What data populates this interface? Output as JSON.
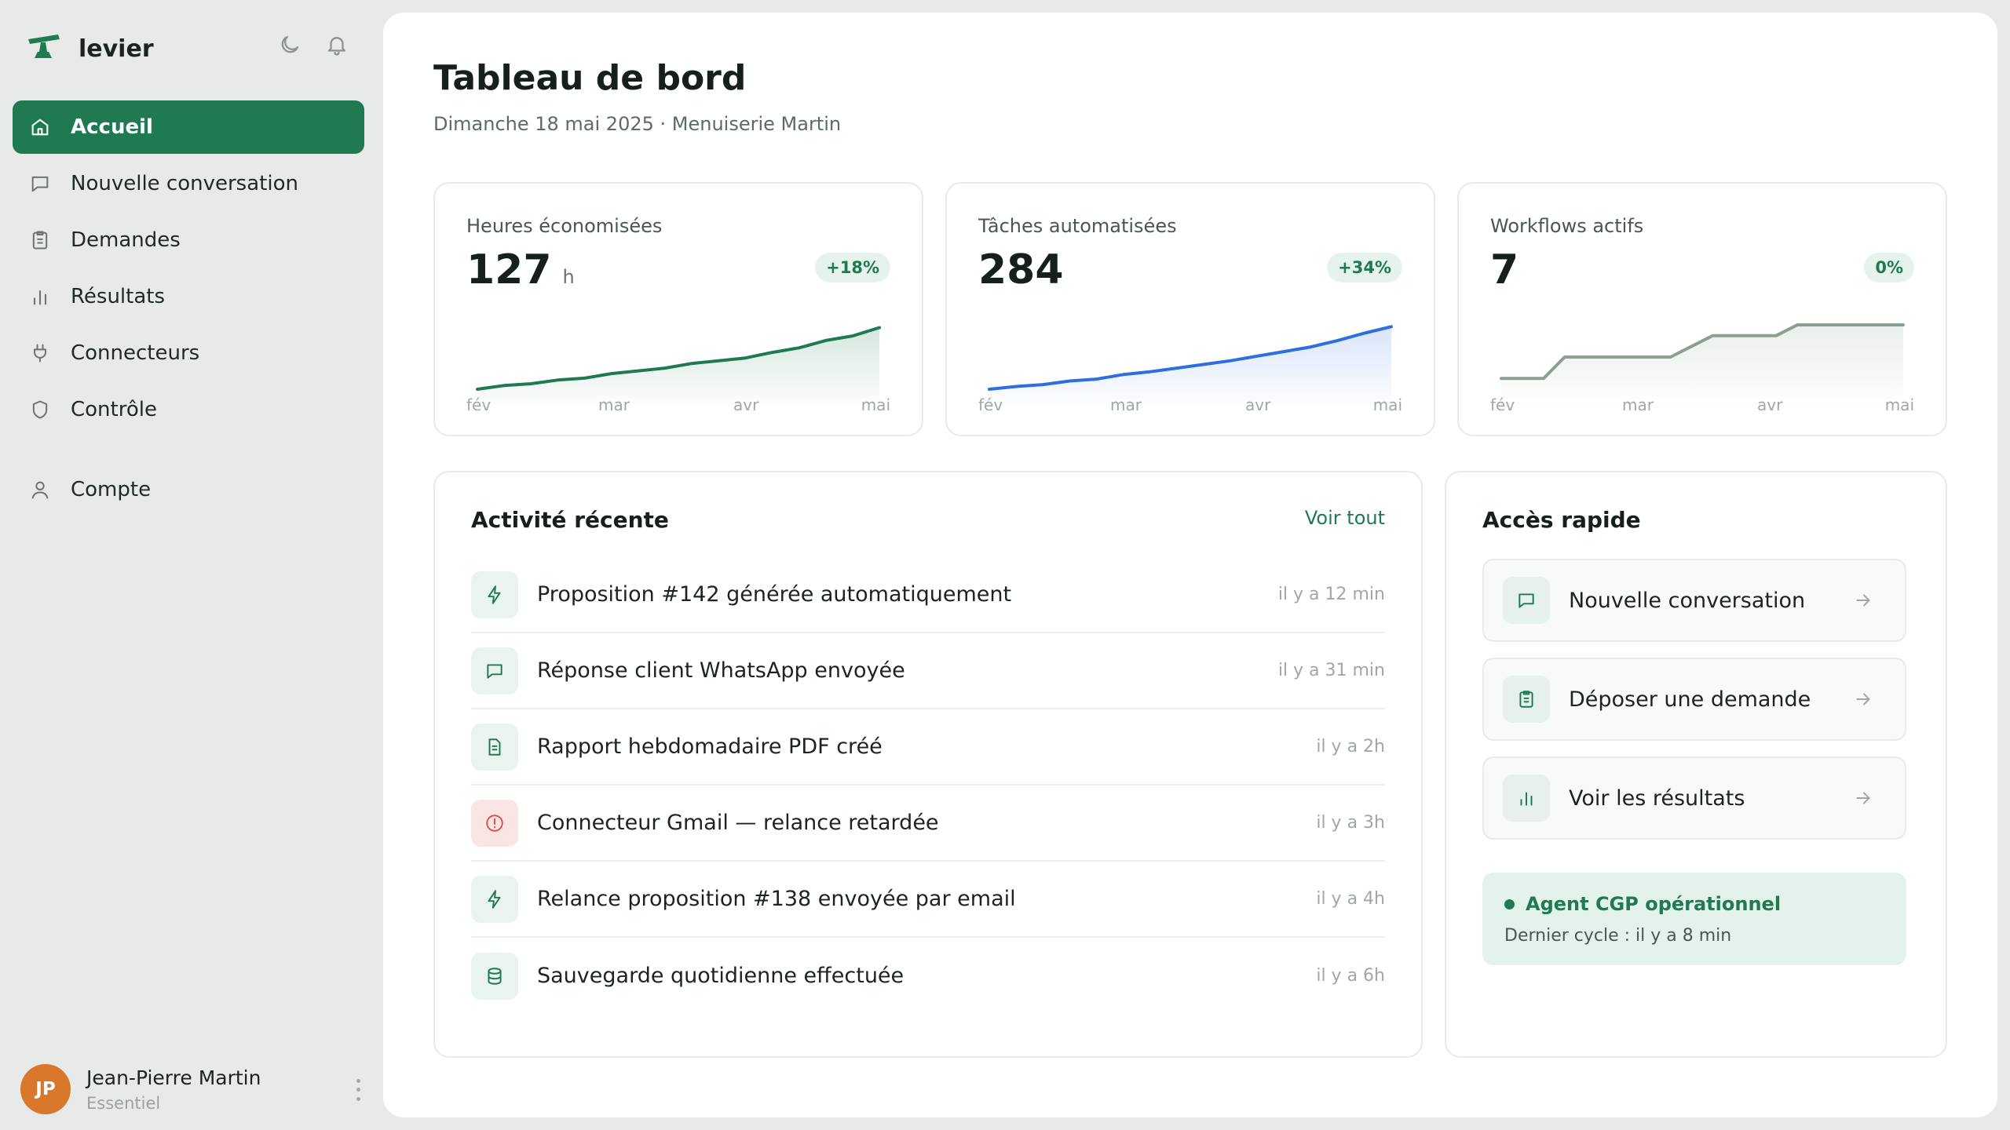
{
  "brand": {
    "name": "levier"
  },
  "colors": {
    "accent": "#1f7a52",
    "blue": "#2f6ee0",
    "gray_line": "#8aa091",
    "warn": "#d9534f",
    "avatar": "#d9772b"
  },
  "header_icons": [
    "moon-icon",
    "bell-icon"
  ],
  "nav": {
    "items": [
      {
        "label": "Accueil",
        "icon": "home-icon",
        "active": true
      },
      {
        "label": "Nouvelle conversation",
        "icon": "chat-icon"
      },
      {
        "label": "Demandes",
        "icon": "clipboard-icon"
      },
      {
        "label": "Résultats",
        "icon": "bar-chart-icon"
      },
      {
        "label": "Connecteurs",
        "icon": "plug-icon"
      },
      {
        "label": "Contrôle",
        "icon": "shield-icon"
      }
    ],
    "account": {
      "label": "Compte",
      "icon": "user-icon"
    }
  },
  "profile": {
    "initials": "JP",
    "name": "Jean-Pierre Martin",
    "plan": "Essentiel"
  },
  "page": {
    "title": "Tableau de bord",
    "subtitle": "Dimanche 18 mai 2025 · Menuiserie Martin"
  },
  "stats": [
    {
      "label": "Heures économisées",
      "value": "127",
      "unit": "h",
      "badge": "+18%",
      "months": [
        "fév",
        "mar",
        "avr",
        "mai"
      ]
    },
    {
      "label": "Tâches automatisées",
      "value": "284",
      "unit": "",
      "badge": "+34%",
      "months": [
        "fév",
        "mar",
        "avr",
        "mai"
      ]
    },
    {
      "label": "Workflows actifs",
      "value": "7",
      "unit": "",
      "badge": "0%",
      "months": [
        "fév",
        "mar",
        "avr",
        "mai"
      ]
    }
  ],
  "chart_data": [
    {
      "type": "area",
      "series": [
        {
          "values": [
            0,
            4,
            6,
            10,
            12,
            17,
            20,
            23,
            28,
            31,
            34,
            40,
            45,
            53,
            58,
            67
          ]
        }
      ],
      "ylim": [
        0,
        70
      ]
    },
    {
      "type": "area",
      "series": [
        {
          "values": [
            0,
            3,
            5,
            9,
            11,
            16,
            19,
            23,
            27,
            31,
            36,
            41,
            46,
            53,
            61,
            68
          ]
        }
      ],
      "ylim": [
        0,
        70
      ]
    },
    {
      "type": "area",
      "series": [
        {
          "values": [
            2,
            2,
            2,
            4,
            4,
            4,
            4,
            4,
            4,
            5,
            6,
            6,
            6,
            6,
            7,
            7,
            7,
            7,
            7,
            7
          ]
        }
      ],
      "ylim": [
        1,
        7
      ]
    }
  ],
  "activity": {
    "title": "Activité récente",
    "see_all": "Voir tout",
    "items": [
      {
        "text": "Proposition #142 générée automatiquement",
        "time": "il y a 12 min",
        "icon": "lightning-icon"
      },
      {
        "text": "Réponse client WhatsApp envoyée",
        "time": "il y a 31 min",
        "icon": "chat-icon"
      },
      {
        "text": "Rapport hebdomadaire PDF créé",
        "time": "il y a 2h",
        "icon": "document-icon"
      },
      {
        "text": "Connecteur Gmail — relance retardée",
        "time": "il y a 3h",
        "icon": "alert-icon",
        "status": "warning"
      },
      {
        "text": "Relance proposition #138 envoyée par email",
        "time": "il y a 4h",
        "icon": "lightning-icon"
      },
      {
        "text": "Sauvegarde quotidienne effectuée",
        "time": "il y a 6h",
        "icon": "database-icon"
      }
    ]
  },
  "quick_access": {
    "title": "Accès rapide",
    "items": [
      {
        "label": "Nouvelle conversation",
        "icon": "chat-icon"
      },
      {
        "label": "Déposer une demande",
        "icon": "clipboard-icon"
      },
      {
        "label": "Voir les résultats",
        "icon": "bar-chart-icon"
      }
    ],
    "agent": {
      "title": "Agent CGP opérationnel",
      "subtitle": "Dernier cycle : il y a 8 min"
    }
  }
}
